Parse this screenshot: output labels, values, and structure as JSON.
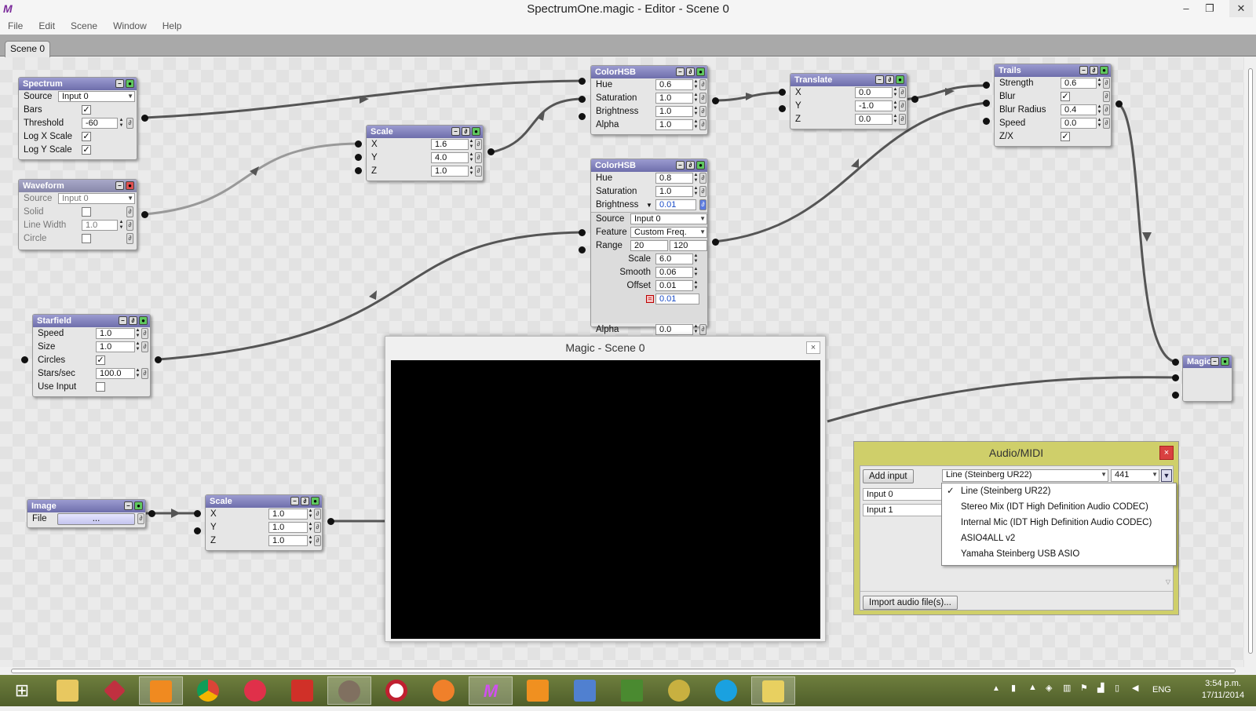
{
  "window": {
    "title": "SpectrumOne.magic - Editor - Scene 0",
    "logo": "M"
  },
  "menu": [
    "File",
    "Edit",
    "Scene",
    "Window",
    "Help"
  ],
  "tab": "Scene 0",
  "nodes": {
    "spectrum": {
      "title": "Spectrum",
      "source_label": "Source",
      "source_value": "Input 0",
      "bars_label": "Bars",
      "threshold_label": "Threshold",
      "threshold_value": "-60",
      "logx_label": "Log X Scale",
      "logy_label": "Log Y Scale"
    },
    "waveform": {
      "title": "Waveform",
      "source_label": "Source",
      "source_value": "Input 0",
      "solid_label": "Solid",
      "linewidth_label": "Line Width",
      "linewidth_value": "1.0",
      "circle_label": "Circle"
    },
    "scale1": {
      "title": "Scale",
      "x_label": "X",
      "x": "1.6",
      "y_label": "Y",
      "y": "4.0",
      "z_label": "Z",
      "z": "1.0"
    },
    "colorhsb1": {
      "title": "ColorHSB",
      "hue_label": "Hue",
      "hue": "0.6",
      "sat_label": "Saturation",
      "sat": "1.0",
      "bri_label": "Brightness",
      "bri": "1.0",
      "alpha_label": "Alpha",
      "alpha": "1.0"
    },
    "colorhsb2": {
      "title": "ColorHSB",
      "hue_label": "Hue",
      "hue": "0.8",
      "sat_label": "Saturation",
      "sat": "1.0",
      "bri_label": "Brightness",
      "bri": "0.01",
      "source_label": "Source",
      "source_value": "Input 0",
      "feature_label": "Feature",
      "feature_value": "Custom Freq.",
      "range_label": "Range",
      "range_min": "20",
      "range_max": "120",
      "scale_label": "Scale",
      "scale": "6.0",
      "smooth_label": "Smooth",
      "smooth": "0.06",
      "offset_label": "Offset",
      "offset": "0.01",
      "value": "0.01",
      "alpha_label": "Alpha",
      "alpha": "0.0"
    },
    "translate": {
      "title": "Translate",
      "x_label": "X",
      "x": "0.0",
      "y_label": "Y",
      "y": "-1.0",
      "z_label": "Z",
      "z": "0.0"
    },
    "trails": {
      "title": "Trails",
      "strength_label": "Strength",
      "strength": "0.6",
      "blur_label": "Blur",
      "blurradius_label": "Blur Radius",
      "blurradius": "0.4",
      "speed_label": "Speed",
      "speed": "0.0",
      "zx_label": "Z/X"
    },
    "starfield": {
      "title": "Starfield",
      "speed_label": "Speed",
      "speed": "1.0",
      "size_label": "Size",
      "size": "1.0",
      "circles_label": "Circles",
      "starsec_label": "Stars/sec",
      "starsec": "100.0",
      "useinput_label": "Use Input"
    },
    "image": {
      "title": "Image",
      "file_label": "File",
      "file_value": "..."
    },
    "scale2": {
      "title": "Scale",
      "x_label": "X",
      "x": "1.0",
      "y_label": "Y",
      "y": "1.0",
      "z_label": "Z",
      "z": "1.0"
    },
    "magic": {
      "title": "Magic"
    }
  },
  "magic_window": {
    "title": "Magic - Scene 0",
    "close": "×"
  },
  "audio": {
    "title": "Audio/MIDI",
    "close": "×",
    "add_input": "Add input",
    "device": "Line (Steinberg UR22)",
    "rate": "441",
    "inputs": [
      "Input 0",
      "Input 1"
    ],
    "import": "Import audio file(s)...",
    "devices": [
      "Line (Steinberg UR22)",
      "Stereo Mix (IDT High Definition Audio CODEC)",
      "Internal Mic (IDT High Definition Audio CODEC)",
      "ASIO4ALL v2",
      "Yamaha Steinberg USB ASIO"
    ],
    "checkmark": "✓"
  },
  "taskbar": {
    "lang": "ENG",
    "time": "3:54 p.m.",
    "date": "17/11/2014"
  },
  "colors": {
    "node_header": "#7a7ab8",
    "audio_bg": "#cfcf6a",
    "taskbar": "#5b6b32"
  }
}
